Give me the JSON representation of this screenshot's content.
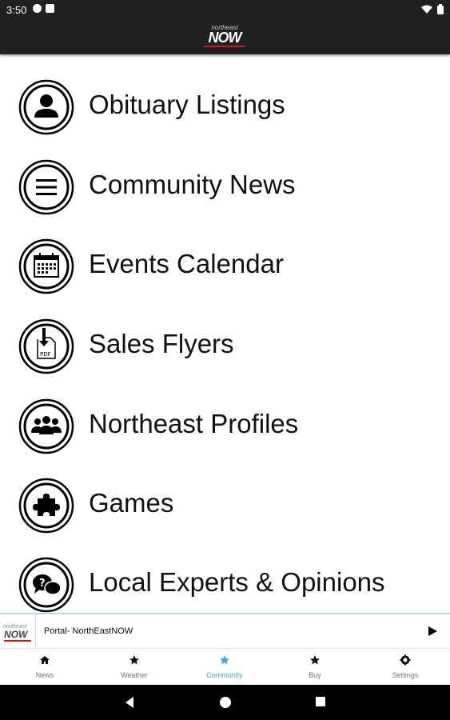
{
  "status_bar": {
    "time": "3:50"
  },
  "app_bar": {
    "logo_small": "northeast",
    "logo_big": "NOW"
  },
  "menu": {
    "items": [
      {
        "label": "Obituary Listings",
        "icon": "person-icon"
      },
      {
        "label": "Community News",
        "icon": "menu-lines-icon"
      },
      {
        "label": "Events Calendar",
        "icon": "calendar-icon"
      },
      {
        "label": "Sales Flyers",
        "icon": "pdf-download-icon"
      },
      {
        "label": "Northeast Profiles",
        "icon": "group-icon"
      },
      {
        "label": "Games",
        "icon": "puzzle-icon"
      },
      {
        "label": "Local Experts & Opinions",
        "icon": "chat-question-icon"
      }
    ]
  },
  "player": {
    "title": "Portal- NorthEastNOW",
    "thumb_small": "northeast",
    "thumb_big": "NOW"
  },
  "tabs": [
    {
      "label": "News",
      "icon": "home-icon",
      "active": false
    },
    {
      "label": "Weather",
      "icon": "star-icon",
      "active": false
    },
    {
      "label": "Community",
      "icon": "star-icon",
      "active": true
    },
    {
      "label": "Buy",
      "icon": "star-icon",
      "active": false
    },
    {
      "label": "Settings",
      "icon": "gear-icon",
      "active": false
    }
  ],
  "colors": {
    "accent": "#39a8dd",
    "bar_dark": "#202020",
    "logo_red": "#dd1111"
  }
}
